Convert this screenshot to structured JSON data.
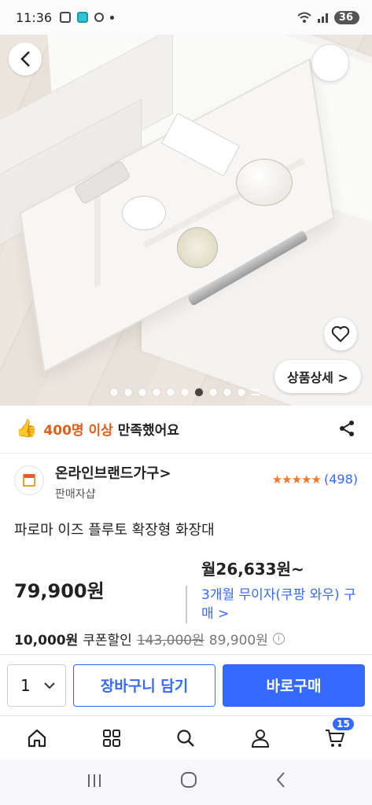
{
  "status_bar": {
    "time": "11:36",
    "battery": "36"
  },
  "hero": {
    "detail_button": "상품상세 >",
    "page_count": 10,
    "active_page": 7
  },
  "satisfaction": {
    "highlight": "400명 이상",
    "rest": "만족했어요"
  },
  "brand": {
    "name": "온라인브랜드가구>",
    "subtitle": "판매자샵",
    "rating": 4.5,
    "rating_count": "(498)"
  },
  "product": {
    "title": "파로마 이즈 플루토 확장형 화장대"
  },
  "price": {
    "main": "79,900원",
    "monthly": "월26,633원~",
    "monthly_sub": "3개월 무이자(쿠팡 와우) 구매 >",
    "coupon_amount": "10,000원",
    "coupon_label": "쿠폰할인",
    "original_price": "143,000원",
    "final_price": "89,900원"
  },
  "buy_bar": {
    "quantity": "1",
    "cart_label": "장바구니 담기",
    "buy_label": "바로구매"
  },
  "bottom_nav": {
    "cart_badge": "15"
  },
  "colors": {
    "accent": "#346aff",
    "highlight": "#e25d1a",
    "star": "#f3782e"
  }
}
